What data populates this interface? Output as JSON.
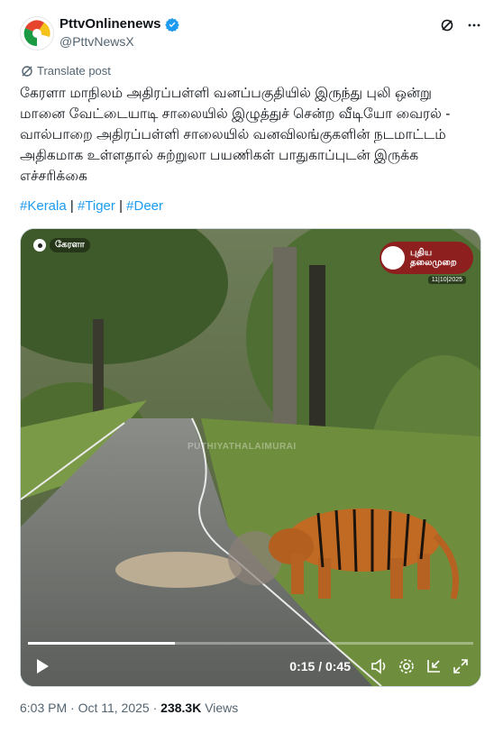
{
  "author": {
    "name": "PttvOnlinenews",
    "handle": "@PttvNewsX"
  },
  "translate_label": "Translate post",
  "text": "கேரளா மாநிலம் அதிரப்பள்ளி வனப்பகுதியில் இருந்து புலி ஒன்று மானை வேட்டையாடி சாலையில் இழுத்துச் சென்ற வீடியோ வைரல் - வால்பாறை அதிரப்பள்ளி சாலையில் வனவிலங்குகளின் நடமாட்டம் அதிகமாக உள்ளதால் சுற்றுலா பயணிகள் பாதுகாப்புடன் இருக்க எச்சரிக்கை",
  "hashtags": [
    "#Kerala",
    "#Tiger",
    "#Deer"
  ],
  "video": {
    "location": "கேரளா",
    "channel_line1": "புதிய",
    "channel_line2": "தலைமுறை",
    "date": "11|10|2025",
    "watermark": "PUTHIYATHALAIMURAI",
    "current_time": "0:15",
    "duration": "0:45",
    "time_display": "0:15 / 0:45",
    "progress_fraction": 0.33
  },
  "posted": "6:03 PM · Oct 11, 2025 · ",
  "views_count": "238.3K",
  "views_label": " Views",
  "colors": {
    "accent": "#1d9bf0",
    "muted": "#536471",
    "channel_red": "#8d1f1f"
  },
  "icons": [
    "verified-badge-icon",
    "grok-icon",
    "more-icon",
    "translate-icon",
    "play-icon",
    "volume-icon",
    "settings-icon",
    "minimize-icon",
    "fullscreen-icon",
    "location-pin-icon"
  ]
}
